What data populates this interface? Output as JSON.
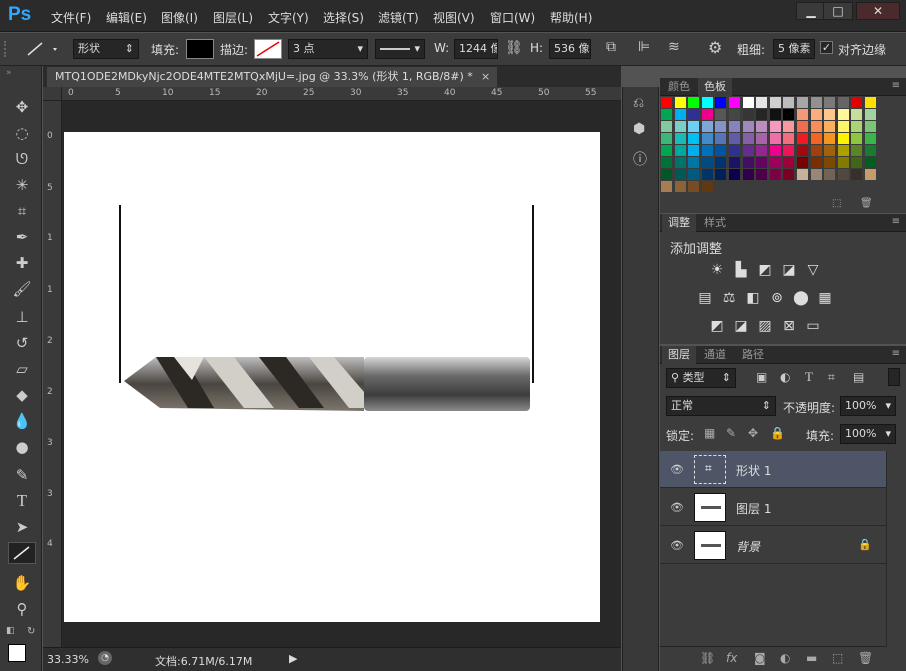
{
  "app": {
    "logo": "Ps"
  },
  "menu": [
    "文件(F)",
    "编辑(E)",
    "图像(I)",
    "图层(L)",
    "文字(Y)",
    "选择(S)",
    "滤镜(T)",
    "视图(V)",
    "窗口(W)",
    "帮助(H)"
  ],
  "window_buttons": {
    "minimize": "▁",
    "maximize": "□",
    "close": "✕"
  },
  "options": {
    "mode": "形状",
    "fill_label": "填充:",
    "stroke_label": "描边:",
    "stroke_width": "3 点",
    "w_label": "W:",
    "w_value": "1244 像",
    "h_label": "H:",
    "h_value": "536 像",
    "weight_label": "粗细:",
    "weight_value": "5 像素",
    "align_edges": "对齐边缘"
  },
  "document": {
    "tab_title": "MTQ1ODE2MDkyNjc2ODE4MTE2MTQxMjU=.jpg @ 33.3% (形状 1, RGB/8#) *",
    "close": "×",
    "ruler_top": [
      "0",
      "5",
      "10",
      "15",
      "20",
      "25",
      "30",
      "35",
      "40",
      "45",
      "50",
      "55"
    ],
    "ruler_left": [
      "0",
      "5",
      "1",
      "1",
      "2",
      "2",
      "3",
      "3",
      "4"
    ]
  },
  "status": {
    "zoom": "33.33%",
    "doc_info": "文档:6.71M/6.17M"
  },
  "color_panel": {
    "tabs": [
      "颜色",
      "色板"
    ]
  },
  "adjust_panel": {
    "tabs": [
      "调整",
      "样式"
    ],
    "title": "添加调整"
  },
  "layers_panel": {
    "tabs": [
      "图层",
      "通道",
      "路径"
    ],
    "filter": "类型",
    "blend_mode": "正常",
    "opacity_label": "不透明度:",
    "opacity": "100%",
    "lock_label": "锁定:",
    "fill_label": "填充:",
    "fill": "100%",
    "layers": [
      {
        "name": "形状 1",
        "selected": true
      },
      {
        "name": "图层 1",
        "selected": false
      },
      {
        "name": "背景",
        "selected": false,
        "locked": true
      }
    ]
  },
  "colors": {
    "accent": "#31a8ff",
    "selected_layer": "#4d5566"
  }
}
